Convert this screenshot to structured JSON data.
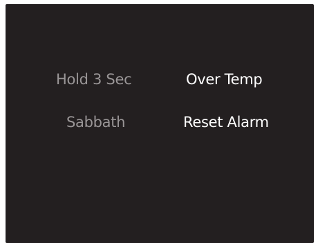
{
  "panel": {
    "hold_label": "Hold 3 Sec",
    "over_temp_label": "Over Temp",
    "sabbath_label": "Sabbath",
    "reset_alarm_label": "Reset Alarm"
  },
  "colors": {
    "screen_background": "#231f20",
    "dim_text": "#9a9697",
    "bright_text": "#ffffff"
  }
}
